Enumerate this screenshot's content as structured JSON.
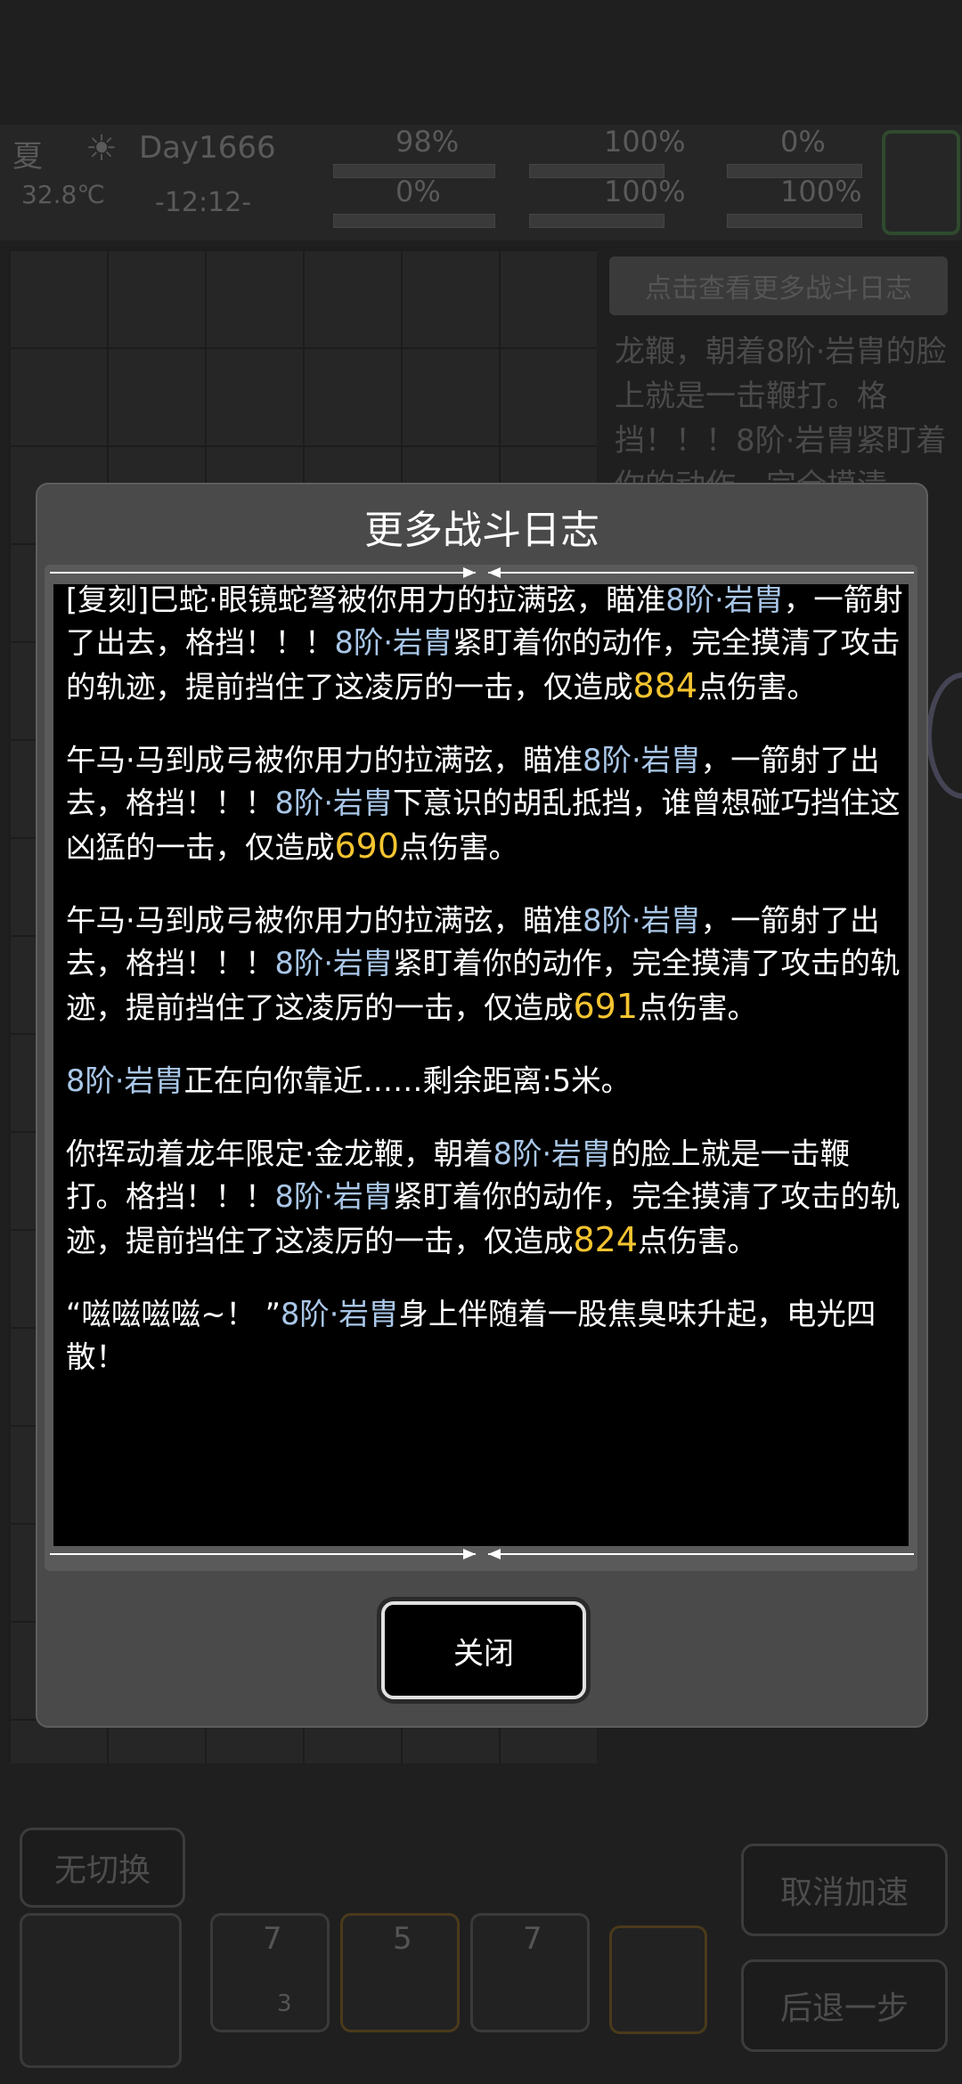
{
  "status": {
    "season": "夏",
    "temperature": "32.8℃",
    "day": "Day1666",
    "time": "-12:12-",
    "stats": [
      "98%",
      "0%",
      "100%",
      "100%",
      "0%",
      "100%"
    ]
  },
  "background": {
    "log_button": "点击查看更多战斗日志",
    "log_preview": "龙鞭，朝着8阶·岩胄的脸上就是一击鞭打。格挡！！！8阶·岩胄紧盯着你的动作，完全摸清",
    "no_switch": "无切换",
    "cancel_speed": "取消加速",
    "step_back": "后退一步",
    "slots": [
      "7",
      "5",
      "7"
    ],
    "slot_badge": "3"
  },
  "modal": {
    "title": "更多战斗日志",
    "close_label": "关闭",
    "entries": [
      [
        {
          "t": "[复刻]巳蛇·眼镜蛇弩被你用力的拉满弦，瞄准"
        },
        {
          "t": "8阶·岩胄",
          "c": "mon"
        },
        {
          "t": "，一箭射了出去，格挡！！！"
        },
        {
          "t": "8阶·岩胄",
          "c": "mon"
        },
        {
          "t": "紧盯着你的动作，完全摸清了攻击的轨迹，提前挡住了这凌厉的一击，仅造成"
        },
        {
          "t": "884",
          "c": "dmg"
        },
        {
          "t": "点伤害。"
        }
      ],
      [
        {
          "t": "午马·马到成弓被你用力的拉满弦，瞄准"
        },
        {
          "t": "8阶·岩胄",
          "c": "mon"
        },
        {
          "t": "，一箭射了出去，格挡！！！"
        },
        {
          "t": "8阶·岩胄",
          "c": "mon"
        },
        {
          "t": "下意识的胡乱抵挡，谁曾想碰巧挡住这凶猛的一击，仅造成"
        },
        {
          "t": "690",
          "c": "dmg"
        },
        {
          "t": "点伤害。"
        }
      ],
      [
        {
          "t": "午马·马到成弓被你用力的拉满弦，瞄准"
        },
        {
          "t": "8阶·岩胄",
          "c": "mon"
        },
        {
          "t": "，一箭射了出去，格挡！！！"
        },
        {
          "t": "8阶·岩胄",
          "c": "mon"
        },
        {
          "t": "紧盯着你的动作，完全摸清了攻击的轨迹，提前挡住了这凌厉的一击，仅造成"
        },
        {
          "t": "691",
          "c": "dmg"
        },
        {
          "t": "点伤害。"
        }
      ],
      [
        {
          "t": "8阶·岩胄",
          "c": "mon"
        },
        {
          "t": "正在向你靠近……剩余距离:5米。"
        }
      ],
      [
        {
          "t": "你挥动着龙年限定·金龙鞭，朝着"
        },
        {
          "t": "8阶·岩胄",
          "c": "mon"
        },
        {
          "t": "的脸上就是一击鞭打。格挡！！！"
        },
        {
          "t": "8阶·岩胄",
          "c": "mon"
        },
        {
          "t": "紧盯着你的动作，完全摸清了攻击的轨迹，提前挡住了这凌厉的一击，仅造成"
        },
        {
          "t": "824",
          "c": "dmg"
        },
        {
          "t": "点伤害。"
        }
      ],
      [
        {
          "t": "“嗞嗞嗞嗞~！ ”"
        },
        {
          "t": "8阶·岩胄",
          "c": "mon"
        },
        {
          "t": "身上伴随着一股焦臭味升起，电光四散！"
        }
      ]
    ]
  },
  "colors": {
    "damage": "#f4c430",
    "monster": "#a9c7e8",
    "modal_bg": "#4a4a4a",
    "log_bg": "#000000"
  }
}
